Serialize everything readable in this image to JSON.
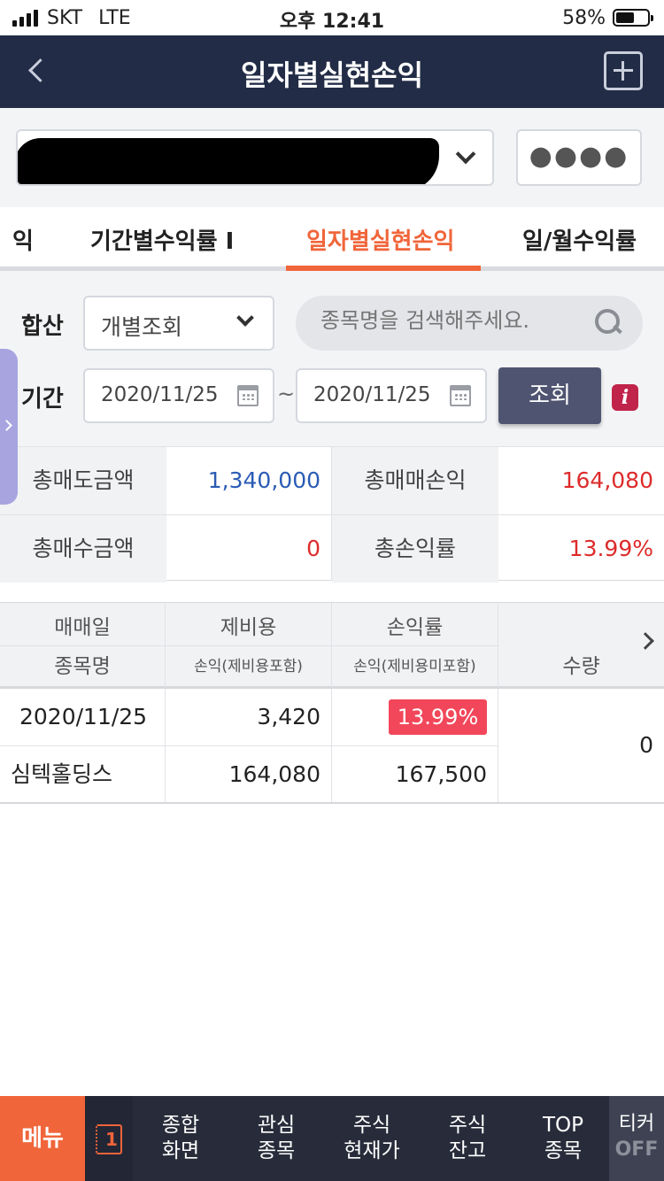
{
  "status_bar": {
    "carrier": "SKT",
    "network": "LTE",
    "time": "오후 12:41",
    "battery": "58%",
    "battery_level": 0.58
  },
  "header": {
    "title": "일자별실현손익"
  },
  "account": {
    "password_mask": "●●●●"
  },
  "tabs": [
    {
      "label": "익"
    },
    {
      "label": "기간별수익률 I"
    },
    {
      "label": "일자별실현손익",
      "active": true
    },
    {
      "label": "일/월수익률"
    }
  ],
  "filters": {
    "sum_label": "합산",
    "mode_value": "개별조회",
    "search_placeholder": "종목명을 검색해주세요.",
    "period_label": "기간",
    "start_date": "2020/11/25",
    "tilde": "~",
    "end_date": "2020/11/25",
    "query_label": "조회",
    "info_label": "i"
  },
  "summary": {
    "total_sell_label": "총매도금액",
    "total_sell_value": "1,340,000",
    "total_pl_label": "총매매손익",
    "total_pl_value": "164,080",
    "total_buy_label": "총매수금액",
    "total_buy_value": "0",
    "total_rate_label": "총손익률",
    "total_rate_value": "13.99%"
  },
  "table": {
    "headers": {
      "trade_date": "매매일",
      "fee": "제비용",
      "rate": "손익률",
      "name": "종목명",
      "pl_incl": "손익(제비용포함)",
      "pl_excl": "손익(제비용미포함)",
      "qty": "수량"
    },
    "rows": [
      {
        "trade_date": "2020/11/25",
        "fee": "3,420",
        "rate": "13.99%",
        "name": "심텍홀딩스",
        "pl_incl": "164,080",
        "pl_excl": "167,500",
        "qty": "0"
      }
    ]
  },
  "bottom_nav": {
    "menu": "메뉴",
    "screen_count": "1",
    "items": [
      {
        "line1": "종합",
        "line2": "화면"
      },
      {
        "line1": "관심",
        "line2": "종목"
      },
      {
        "line1": "주식",
        "line2": "현재가"
      },
      {
        "line1": "주식",
        "line2": "잔고"
      },
      {
        "line1": "TOP",
        "line2": "종목"
      }
    ],
    "ticker_top": "티커",
    "ticker_bottom": "OFF"
  },
  "colors": {
    "header_bg": "#222c46",
    "accent": "#f0653a",
    "positive_red": "#dd2b2b",
    "blue_value": "#2a5bb5",
    "badge_red": "#f2475a"
  }
}
